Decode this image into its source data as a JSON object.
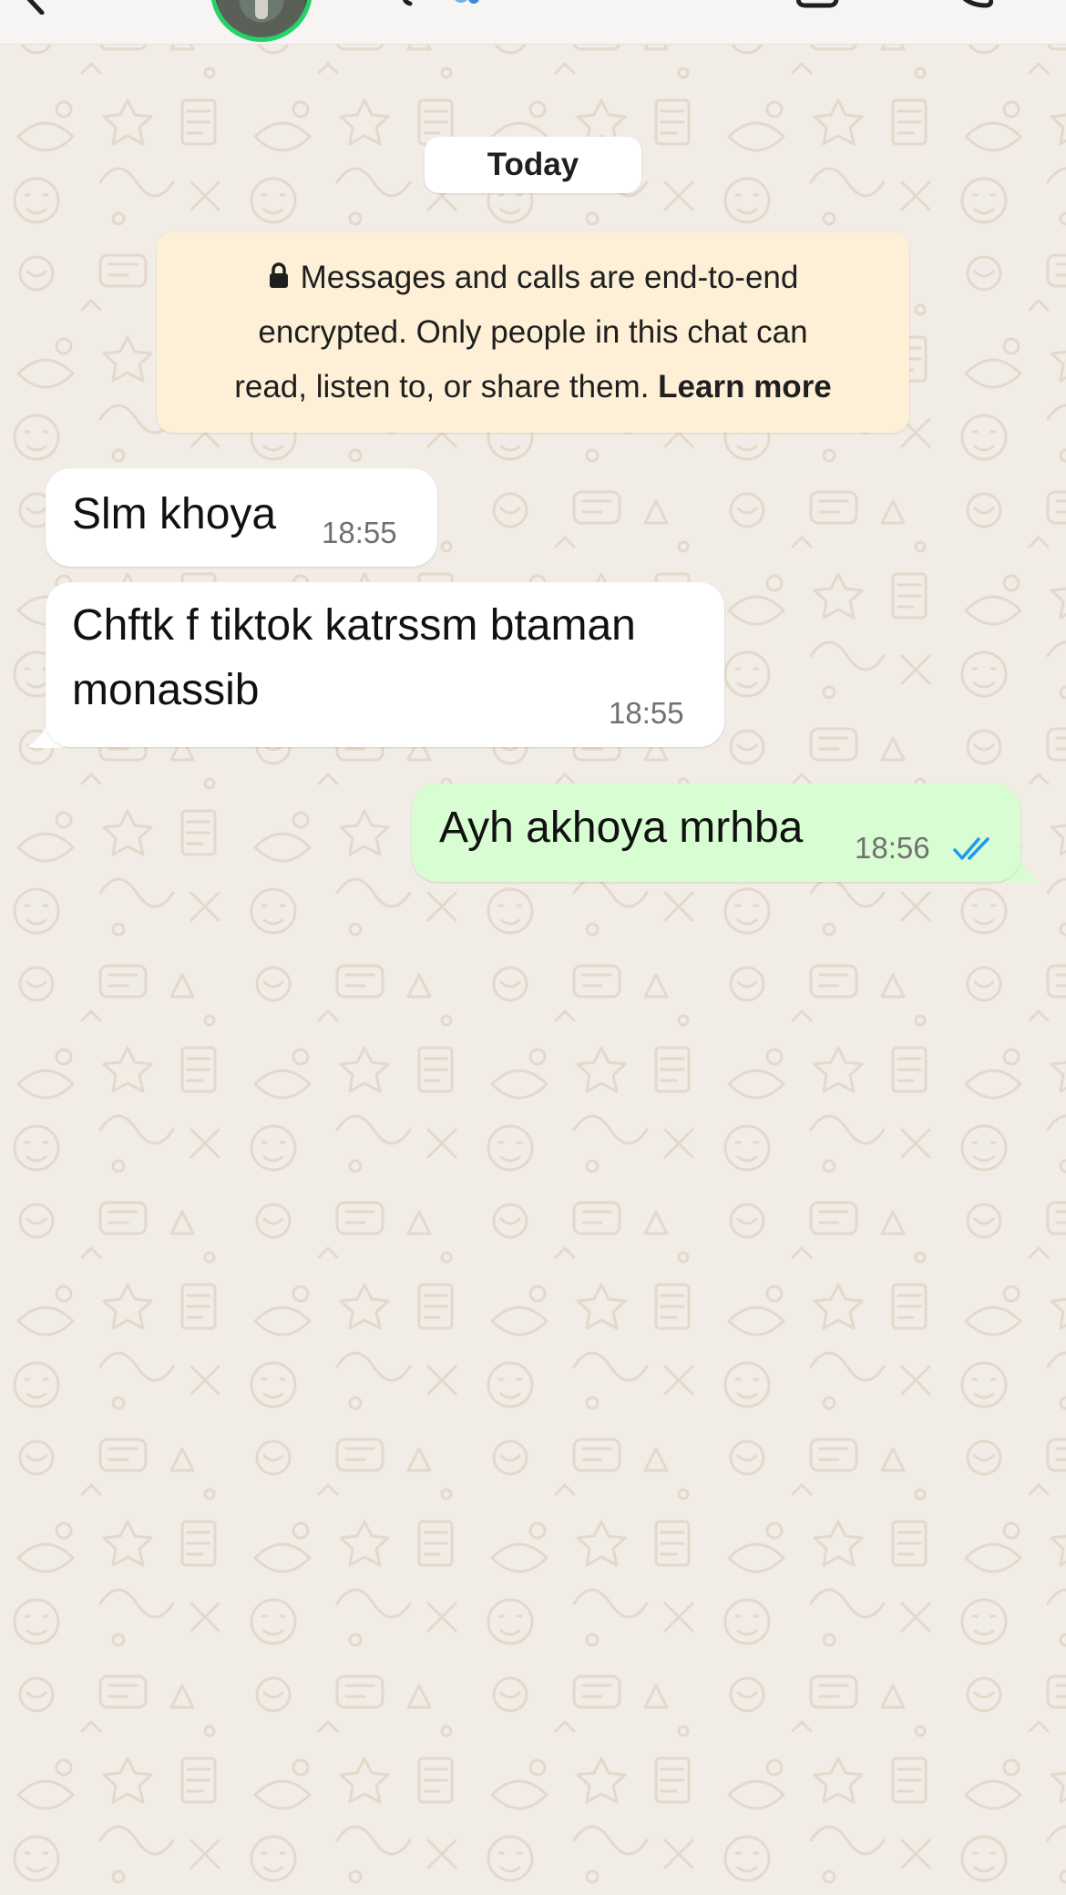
{
  "header": {
    "back_icon": "chevron-left-icon",
    "video_icon": "video-camera-icon",
    "call_icon": "phone-icon",
    "status_ring_color": "#25d366"
  },
  "chat": {
    "date_label": "Today",
    "encryption": {
      "icon": "lock-icon",
      "line1": "Messages and calls are end-to-end",
      "line2": "encrypted. Only people in this chat can",
      "line3_prefix": "read, listen to, or share them. ",
      "learn_more": "Learn more"
    },
    "messages": [
      {
        "direction": "incoming",
        "text": "Slm khoya",
        "time": "18:55"
      },
      {
        "direction": "incoming",
        "text_line1": "Chftk f tiktok katrssm btaman",
        "text_line2": "monassib",
        "time": "18:55"
      },
      {
        "direction": "outgoing",
        "text": "Ayh akhoya mrhba",
        "time": "18:56",
        "status": "read",
        "status_icon": "double-check-icon",
        "status_color": "#1a9bf0"
      }
    ]
  },
  "colors": {
    "incoming_bubble": "#ffffff",
    "outgoing_bubble": "#d9fdd3",
    "encryption_notice": "#fdf0d7",
    "wallpaper": "#f1ece5"
  }
}
